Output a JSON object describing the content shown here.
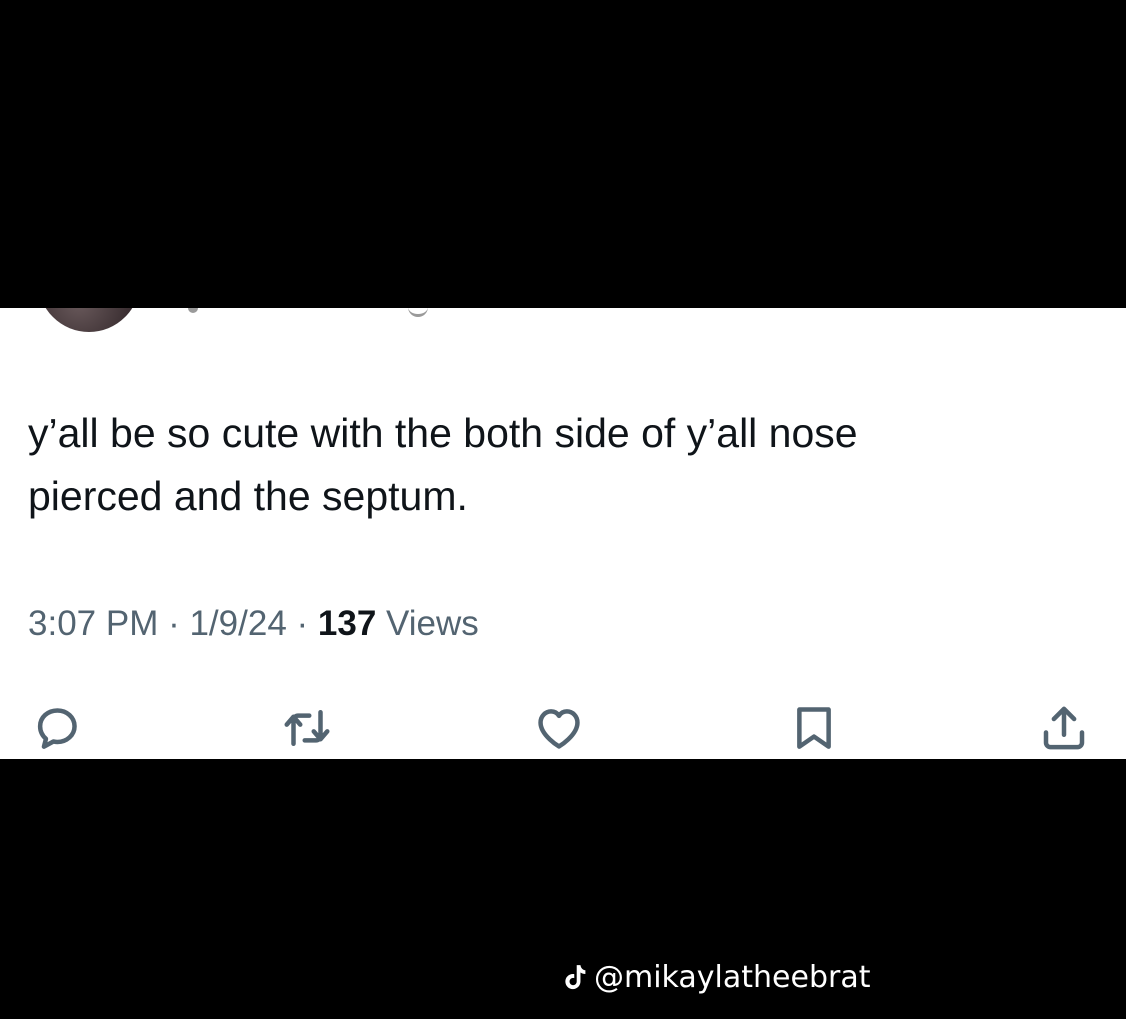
{
  "tweet": {
    "text": "y’all be so cute with the both side of y’all nose\npierced and the septum.",
    "time": "3:07 PM",
    "date": "1/9/24",
    "separator": " · ",
    "views_count": "137",
    "views_label": " Views"
  },
  "actions": {
    "reply_icon": "reply-icon",
    "retweet_icon": "retweet-icon",
    "like_icon": "heart-icon",
    "bookmark_icon": "bookmark-icon",
    "share_icon": "share-icon"
  },
  "watermark": {
    "icon": "tiktok-icon",
    "handle": "@mikaylatheebrat"
  },
  "colors": {
    "background": "#000000",
    "card": "#ffffff",
    "text": "#0f1419",
    "secondary": "#536471",
    "watermark": "#ffffff"
  }
}
